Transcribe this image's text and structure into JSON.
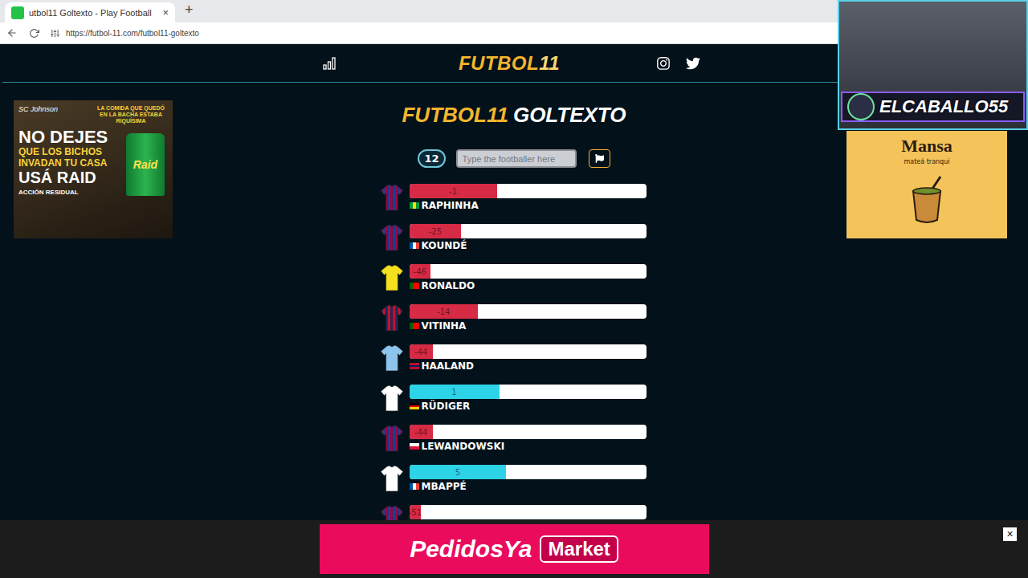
{
  "browser": {
    "tab_title": "utbol11 Goltexto - Play Football",
    "tab_close": "×",
    "new_tab": "+",
    "url": "https://futbol-11.com/futbol11-goltexto"
  },
  "header": {
    "logo": {
      "word": "FUTBOL",
      "number": "11"
    }
  },
  "title": {
    "brand": "FUTBOL11",
    "game": "GOLTEXTO"
  },
  "search": {
    "attempts": "12",
    "placeholder": "Type the footballer here"
  },
  "players": [
    {
      "name": "RAPHINHA",
      "reading": "-1",
      "level": 0.37,
      "color": "#d62a45",
      "shirt": {
        "kind": "striped",
        "colors": [
          "#a50044",
          "#1d3f8c"
        ]
      },
      "flag": {
        "kind": "vertical",
        "colors": [
          "#009c3b",
          "#ffdf00",
          "#009c3b"
        ]
      }
    },
    {
      "name": "KOUNDÉ",
      "reading": "-25",
      "level": 0.22,
      "color": "#d62a45",
      "shirt": {
        "kind": "striped",
        "colors": [
          "#a50044",
          "#1d3f8c"
        ]
      },
      "flag": {
        "kind": "vertical",
        "colors": [
          "#0055a4",
          "#ffffff",
          "#ef4135"
        ]
      }
    },
    {
      "name": "RONALDO",
      "reading": "-46",
      "level": 0.09,
      "color": "#d62a45",
      "shirt": {
        "kind": "plain",
        "colors": [
          "#f4e01c"
        ]
      },
      "flag": {
        "kind": "vertical",
        "colors": [
          "#006600",
          "#ff0000",
          "#ff0000"
        ]
      }
    },
    {
      "name": "VITINHA",
      "reading": "-14",
      "level": 0.29,
      "color": "#d62a45",
      "shirt": {
        "kind": "striped",
        "colors": [
          "#1b2c5c",
          "#c8102e"
        ]
      },
      "flag": {
        "kind": "vertical",
        "colors": [
          "#006600",
          "#ff0000",
          "#ff0000"
        ]
      }
    },
    {
      "name": "HAALAND",
      "reading": "-44",
      "level": 0.1,
      "color": "#d62a45",
      "shirt": {
        "kind": "plain",
        "colors": [
          "#8cc4ec"
        ]
      },
      "flag": {
        "kind": "horizontal",
        "colors": [
          "#ba0c2f",
          "#00205b",
          "#ba0c2f"
        ]
      }
    },
    {
      "name": "RÜDIGER",
      "reading": "1",
      "level": 0.38,
      "color": "#2dd3e6",
      "shirt": {
        "kind": "plain",
        "colors": [
          "#ffffff"
        ]
      },
      "flag": {
        "kind": "horizontal",
        "colors": [
          "#000000",
          "#dd0000",
          "#ffce00"
        ]
      }
    },
    {
      "name": "LEWANDOWSKI",
      "reading": "-44",
      "level": 0.1,
      "color": "#d62a45",
      "shirt": {
        "kind": "striped",
        "colors": [
          "#a50044",
          "#1d3f8c"
        ]
      },
      "flag": {
        "kind": "horizontal",
        "colors": [
          "#ffffff",
          "#dc143c"
        ]
      }
    },
    {
      "name": "MBAPPÉ",
      "reading": "5",
      "level": 0.41,
      "color": "#2dd3e6",
      "shirt": {
        "kind": "plain",
        "colors": [
          "#ffffff"
        ]
      },
      "flag": {
        "kind": "vertical",
        "colors": [
          "#0055a4",
          "#ffffff",
          "#ef4135"
        ]
      }
    },
    {
      "reading": "-51",
      "level": 0.05,
      "color": "#d62a45",
      "shirt": {
        "kind": "striped",
        "colors": [
          "#a50044",
          "#1d3f8c"
        ]
      }
    }
  ],
  "ads": {
    "left": {
      "brand": "SC Johnson",
      "bubble": "LA COMIDA QUE QUEDÓ EN LA BACHA ESTABA RIQUÍSIMA",
      "lines": [
        "NO DEJES",
        "QUE LOS BICHOS",
        "INVADAN TU CASA",
        "USÁ RAID"
      ],
      "badge": "ACCIÓN RESIDUAL",
      "product": "Raid"
    },
    "right": {
      "brand": "Mansa",
      "tagline": "mateá tranqui"
    },
    "bottom": {
      "brand": "PedidosYa",
      "tag": "Market",
      "close": "×"
    }
  },
  "stream": {
    "channel": "ELCABALLO55"
  }
}
